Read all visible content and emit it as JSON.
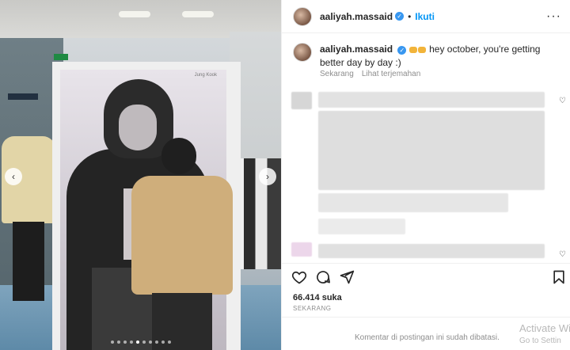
{
  "post": {
    "carousel": {
      "prev_icon": "chevron-left-icon",
      "next_icon": "chevron-right-icon",
      "poster_label": "Jung Kook",
      "slide_count": 10,
      "active_slide": 5
    },
    "header": {
      "username": "aaliyah.massaid",
      "verified_badge": "✓",
      "separator": "•",
      "follow_label": "Ikuti",
      "more_label": "···"
    },
    "caption": {
      "username": "aaliyah.massaid",
      "verified_badge": "✓",
      "text": "hey october, you're getting better day by day :)",
      "timestamp": "Sekarang",
      "translate_label": "Lihat terjemahan"
    },
    "engagement": {
      "likes": "66.414 suka",
      "date": "SEKARANG"
    },
    "footer": {
      "comments_disabled": "Komentar di postingan ini sudah dibatasi."
    },
    "overlay": {
      "line1": "Activate Wi",
      "line2": "Go to Settin"
    },
    "colors": {
      "accent": "#0095f6",
      "verified": "#3897f0",
      "muted": "#8e8e8e"
    }
  }
}
